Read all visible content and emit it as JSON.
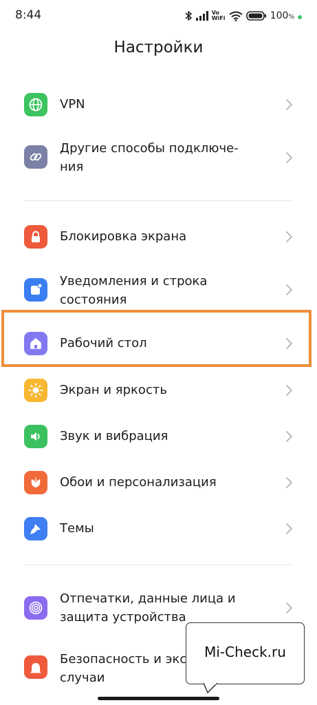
{
  "status_bar": {
    "time": "8:44",
    "volte_line1": "Vo",
    "volte_line2": "WiFi",
    "battery": "100",
    "battery_unit": "%",
    "icons": [
      "bluetooth-icon",
      "signal-icon",
      "volte-wifi-label",
      "wifi-icon",
      "battery-icon",
      "green-dot"
    ]
  },
  "header": {
    "title": "Настройки"
  },
  "settings": {
    "vpn": {
      "label": "VPN",
      "icon": "globe-icon",
      "color": "#3dc35f"
    },
    "other_connections": {
      "label": "Другие способы подключе-\nния",
      "icon": "link-icon",
      "color": "#7b80a6"
    },
    "lock_screen": {
      "label": "Блокировка экрана",
      "icon": "lock-icon",
      "color": "#ef5a3c"
    },
    "notifications": {
      "label": "Уведомления и строка\nсостояния",
      "icon": "notification-icon",
      "color": "#3a7ef2"
    },
    "desktop": {
      "label": "Рабочий стол",
      "icon": "home-icon",
      "color": "#8279f0"
    },
    "display": {
      "label": "Экран и яркость",
      "icon": "sun-icon",
      "color": "#f7b731"
    },
    "sound": {
      "label": "Звук и вибрация",
      "icon": "speaker-icon",
      "color": "#3cc160"
    },
    "wallpaper": {
      "label": "Обои и персонализация",
      "icon": "flower-icon",
      "color": "#f06a3a"
    },
    "themes": {
      "label": "Темы",
      "icon": "brush-icon",
      "color": "#3f7ef3"
    },
    "fingerprint": {
      "label": "Отпечатки, данные лица и\nзащита устройства",
      "icon": "fingerprint-icon",
      "color": "#8a6cf0"
    },
    "security": {
      "label": "Безопасность и экстренные\nслучаи",
      "icon": "security-icon",
      "color": "#ef5a3c"
    }
  },
  "highlight_color": "#ee8e3c",
  "watermark": {
    "text": "Mi-Check.ru"
  }
}
